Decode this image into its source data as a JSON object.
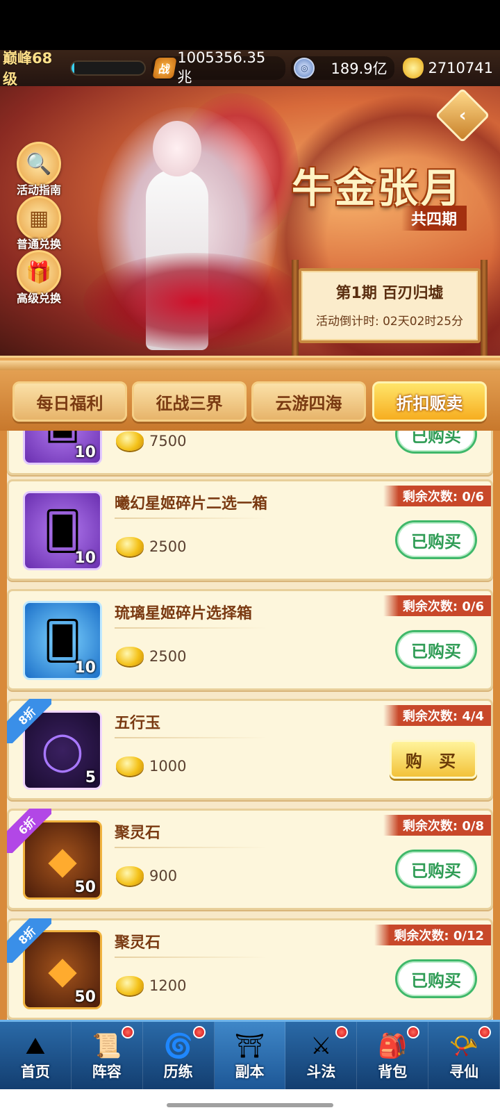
{
  "resources": {
    "level": "巅峰68级",
    "level_progress": 0.04,
    "power_icon": "战",
    "power": "1005356.35兆",
    "coin": "189.9亿",
    "ingot": "2710741"
  },
  "banner": {
    "event_title": "牛金张月",
    "event_sub": "共四期",
    "period_title": "第1期  百刃归墟",
    "countdown": "活动倒计时: 02天02时25分",
    "side_buttons": [
      {
        "label": "活动指南",
        "icon": "magnifier-icon"
      },
      {
        "label": "普通兑换",
        "icon": "gift-box-icon"
      },
      {
        "label": "高级兑换",
        "icon": "gift-box-icon"
      }
    ],
    "back_icon": "back-arrow-icon"
  },
  "tabs": [
    {
      "label": "每日福利",
      "active": false
    },
    {
      "label": "征战三界",
      "active": false
    },
    {
      "label": "云游四海",
      "active": false
    },
    {
      "label": "折扣贩卖",
      "active": true
    }
  ],
  "shop": {
    "items": [
      {
        "name": "",
        "qty": "10",
        "price": "7500",
        "remain": "",
        "button": "已购买",
        "discount": ""
      },
      {
        "name": "曦幻星姬碎片二选一箱",
        "qty": "10",
        "price": "2500",
        "remain": "剩余次数: 0/6",
        "button": "已购买",
        "discount": ""
      },
      {
        "name": "琉璃星姬碎片选择箱",
        "qty": "10",
        "price": "2500",
        "remain": "剩余次数: 0/6",
        "button": "已购买",
        "discount": ""
      },
      {
        "name": "五行玉",
        "qty": "5",
        "price": "1000",
        "remain": "剩余次数: 4/4",
        "button": "购 买",
        "discount": "8折"
      },
      {
        "name": "聚灵石",
        "qty": "50",
        "price": "900",
        "remain": "剩余次数: 0/8",
        "button": "已购买",
        "discount": "6折"
      },
      {
        "name": "聚灵石",
        "qty": "50",
        "price": "1200",
        "remain": "剩余次数: 0/12",
        "button": "已购买",
        "discount": "8折"
      }
    ]
  },
  "nav": [
    {
      "label": "首页",
      "dot": false
    },
    {
      "label": "阵容",
      "dot": true
    },
    {
      "label": "历练",
      "dot": true
    },
    {
      "label": "副本",
      "dot": false
    },
    {
      "label": "斗法",
      "dot": true
    },
    {
      "label": "背包",
      "dot": true
    },
    {
      "label": "寻仙",
      "dot": true
    }
  ],
  "colors": {
    "bought_green": "#2f9c55",
    "remain_red": "#c8482a",
    "active_tab": "#f6ad20",
    "nav_blue": "#133e70"
  }
}
